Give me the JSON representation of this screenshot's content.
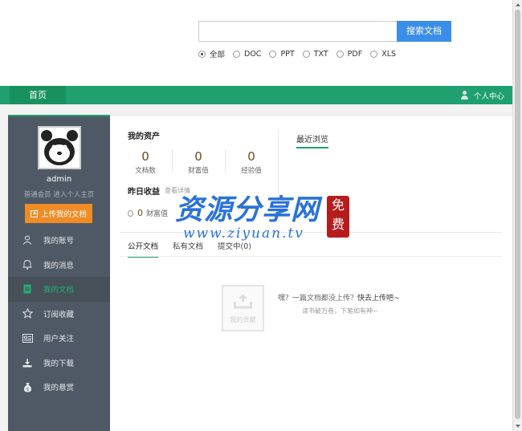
{
  "search": {
    "placeholder": "",
    "button_label": "搜索文档",
    "filters": [
      {
        "label": "全部",
        "selected": true
      },
      {
        "label": "DOC",
        "selected": false
      },
      {
        "label": "PPT",
        "selected": false
      },
      {
        "label": "TXT",
        "selected": false
      },
      {
        "label": "PDF",
        "selected": false
      },
      {
        "label": "XLS",
        "selected": false
      }
    ]
  },
  "nav": {
    "home_label": "首页",
    "user_center_label": "个人中心"
  },
  "sidebar": {
    "username": "admin",
    "member_text": "普通会员  进入个人主页",
    "upload_label": "上传我的文档",
    "items": [
      {
        "label": "我的账号",
        "icon": "user-icon",
        "active": false
      },
      {
        "label": "我的消息",
        "icon": "bell-icon",
        "active": false
      },
      {
        "label": "我的文档",
        "icon": "document-icon",
        "active": true
      },
      {
        "label": "订阅收藏",
        "icon": "star-icon",
        "active": false
      },
      {
        "label": "用户关注",
        "icon": "id-card-icon",
        "active": false
      },
      {
        "label": "我的下载",
        "icon": "download-icon",
        "active": false
      },
      {
        "label": "我的悬赏",
        "icon": "money-bag-icon",
        "active": false
      }
    ]
  },
  "assets": {
    "title": "我的资产",
    "stats": [
      {
        "value": "0",
        "label": "文档数"
      },
      {
        "value": "0",
        "label": "财富值"
      },
      {
        "value": "0",
        "label": "经验值"
      }
    ],
    "yesterday_title": "昨日收益",
    "view_detail": "查看详情",
    "wealth_value": "0",
    "wealth_label": "财富值"
  },
  "recent": {
    "title": "最近浏览"
  },
  "tabs": [
    {
      "label": "公开文档",
      "active": true
    },
    {
      "label": "私有文档",
      "active": false
    },
    {
      "label": "提交中(0)",
      "active": false
    }
  ],
  "empty": {
    "box_label": "我的贡献",
    "message_prefix": "嘿？一篇文档都没上传？",
    "message_highlight": "快去上传吧~",
    "sub": "读书破万卷，下笔如有神~"
  },
  "watermark": {
    "cn": "资源分享网",
    "url": "www.ziyuan.tv",
    "seal": "免费"
  },
  "colors": {
    "brand_green": "#1fa06e",
    "search_blue": "#3b8ee8",
    "upload_orange": "#ef8c26",
    "sidebar_bg": "#4f5965"
  }
}
